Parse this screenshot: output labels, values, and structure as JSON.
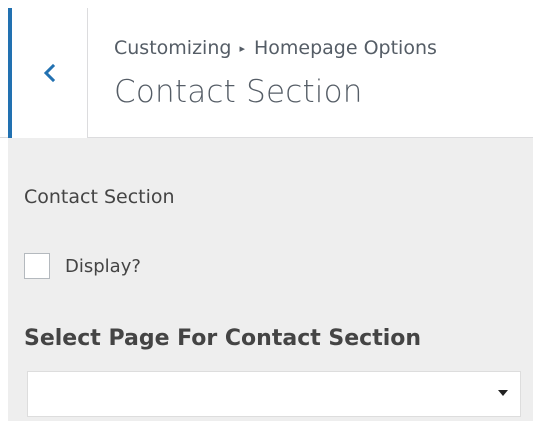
{
  "header": {
    "breadcrumb": {
      "parent": "Customizing",
      "separator": "▸",
      "current": "Homepage Options"
    },
    "title": "Contact Section",
    "back_icon": "chevron-left-icon"
  },
  "section": {
    "label": "Contact Section",
    "display_checkbox": {
      "label": "Display?",
      "checked": false
    },
    "select": {
      "label": "Select Page For Contact Section",
      "value": "",
      "arrow_icon": "caret-down-icon"
    }
  },
  "colors": {
    "accent": "#2271b1",
    "panel_bg": "#eeeeee",
    "text": "#444444"
  }
}
